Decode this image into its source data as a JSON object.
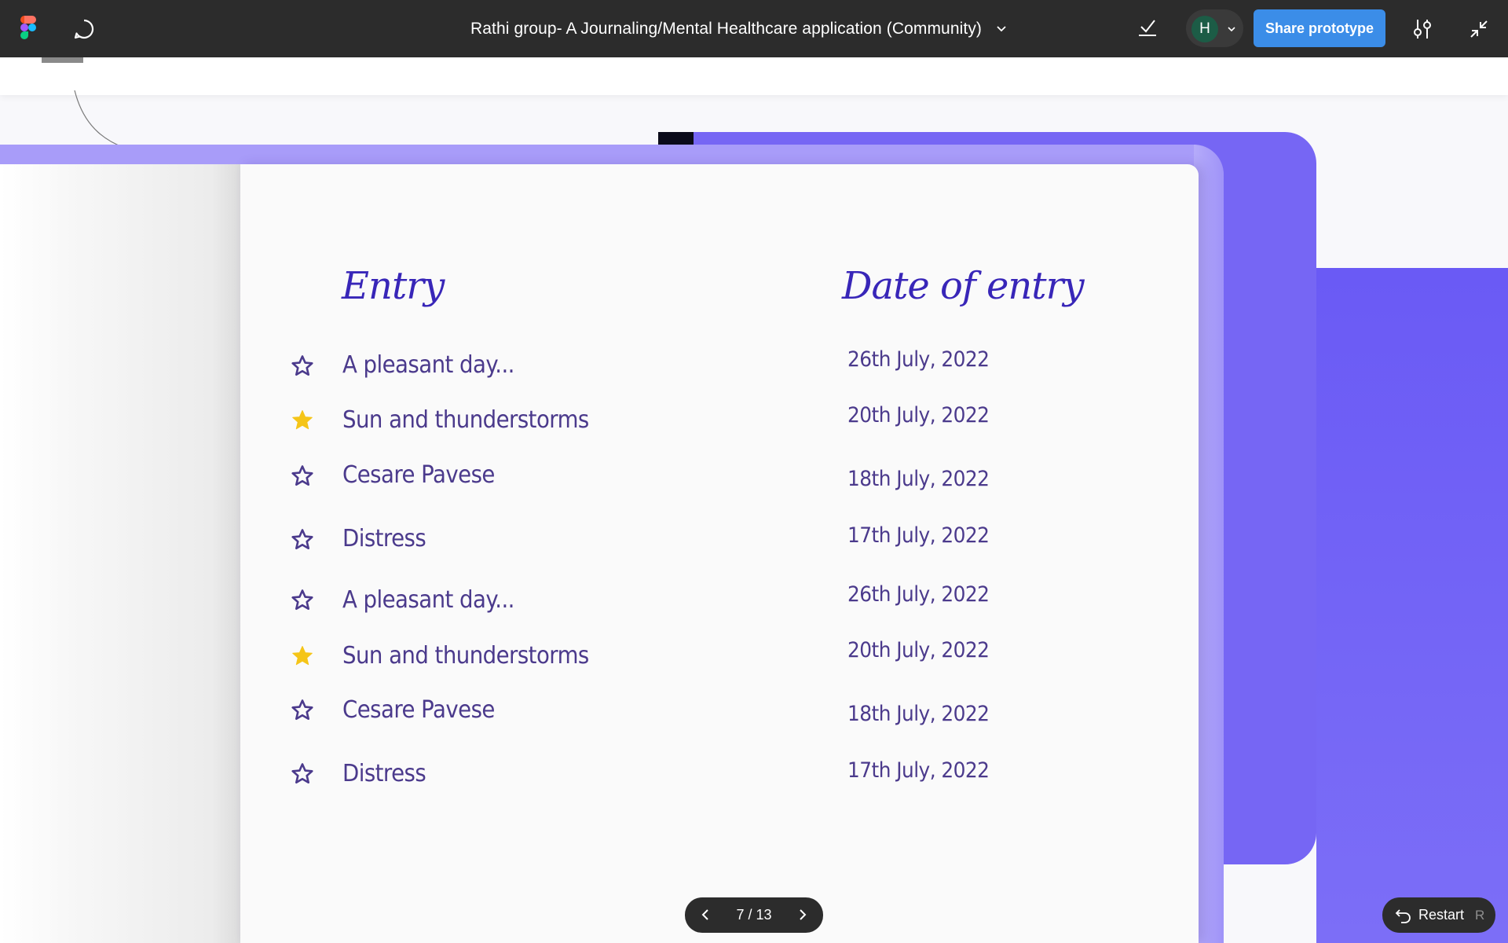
{
  "toolbar": {
    "title": "Rathi group- A Journaling/Mental Healthcare application (Community)",
    "avatar_initial": "H",
    "share_label": "Share prototype",
    "icons": [
      "figma-logo-icon",
      "comment-icon",
      "chevron-down-icon",
      "checkmark-icon",
      "settings-sliders-icon",
      "collapse-icon"
    ]
  },
  "journal": {
    "entry_heading": "Entry",
    "date_heading": "Date of entry",
    "star_filled_color": "#f5c518",
    "star_outline_color": "#4b3a8c",
    "rows": [
      {
        "title": "A pleasant day...",
        "date": "26th July, 2022",
        "starred": false
      },
      {
        "title": "Sun and thunderstorms",
        "date": "20th July, 2022",
        "starred": true
      },
      {
        "title": "Cesare Pavese",
        "date": "18th July, 2022",
        "starred": false
      },
      {
        "title": "Distress",
        "date": "17th July, 2022",
        "starred": false
      },
      {
        "title": "A pleasant day...",
        "date": "26th July, 2022",
        "starred": false
      },
      {
        "title": "Sun and thunderstorms",
        "date": "20th July, 2022",
        "starred": true
      },
      {
        "title": "Cesare Pavese",
        "date": "18th July, 2022",
        "starred": false
      },
      {
        "title": "Distress",
        "date": "17th July, 2022",
        "starred": false
      }
    ]
  },
  "pager": {
    "text": "7 / 13",
    "current": 7,
    "total": 13
  },
  "restart": {
    "label": "Restart",
    "shortcut": "R"
  },
  "colors": {
    "toolbar_bg": "#2c2c2c",
    "share_button": "#3b8de8",
    "accent_purple": "#7666f4",
    "heading_purple": "#3826b8"
  }
}
